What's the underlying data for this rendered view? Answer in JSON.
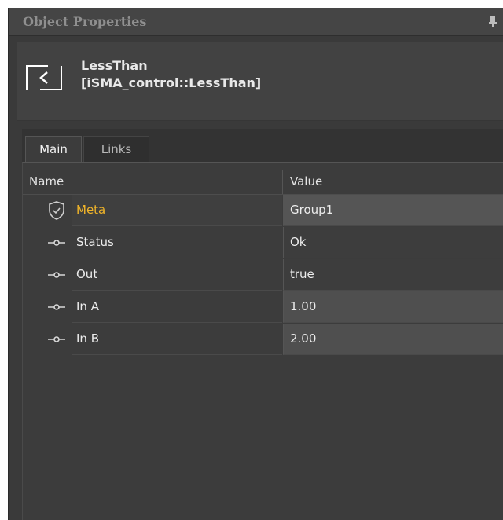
{
  "panel": {
    "title": "Object Properties"
  },
  "object": {
    "name": "LessThan",
    "type": "[iSMA_control::LessThan]"
  },
  "tabs": [
    {
      "label": "Main"
    },
    {
      "label": "Links"
    }
  ],
  "grid": {
    "columns": {
      "name": "Name",
      "value": "Value"
    },
    "rows": [
      {
        "icon": "shield-icon",
        "name": "Meta",
        "value": "Group1"
      },
      {
        "icon": "slot-icon",
        "name": "Status",
        "value": "Ok"
      },
      {
        "icon": "slot-icon",
        "name": "Out",
        "value": "true"
      },
      {
        "icon": "slot-icon",
        "name": "In A",
        "value": "1.00"
      },
      {
        "icon": "slot-icon",
        "name": "In B",
        "value": "2.00"
      }
    ]
  },
  "colors": {
    "accent": "#f0b429",
    "panel_bg": "#3a3a3a"
  }
}
